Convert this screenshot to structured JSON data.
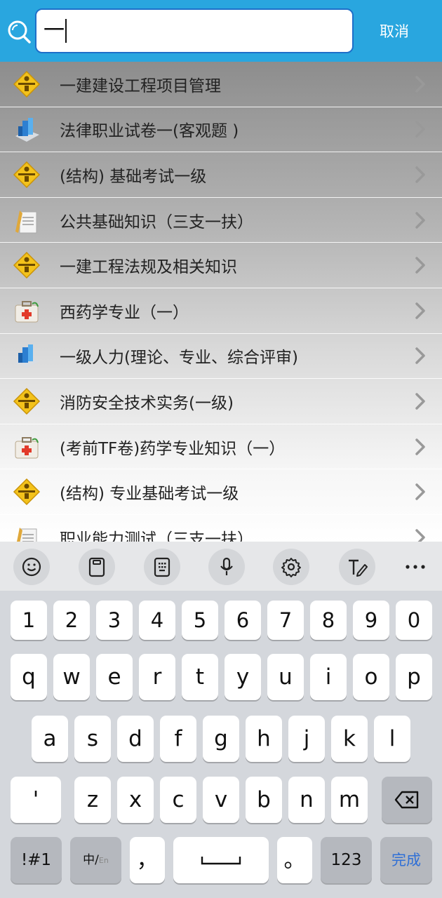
{
  "search": {
    "value": "一",
    "cancel_label": "取消"
  },
  "results": [
    {
      "label": "一建建设工程项目管理",
      "icon": "construction-sign-icon"
    },
    {
      "label": "法律职业试卷一(客观题 )",
      "icon": "buildings-icon"
    },
    {
      "label": "(结构) 基础考试一级",
      "icon": "construction-sign-icon"
    },
    {
      "label": "公共基础知识（三支一扶）",
      "icon": "document-icon"
    },
    {
      "label": "一建工程法规及相关知识",
      "icon": "construction-sign-icon"
    },
    {
      "label": "西药学专业（一）",
      "icon": "medical-kit-icon"
    },
    {
      "label": "一级人力(理论、专业、综合评审)",
      "icon": "buildings-icon"
    },
    {
      "label": "消防安全技术实务(一级)",
      "icon": "construction-sign-icon"
    },
    {
      "label": "(考前TF卷)药学专业知识（一）",
      "icon": "medical-kit-icon"
    },
    {
      "label": "(结构) 专业基础考试一级",
      "icon": "construction-sign-icon"
    },
    {
      "label": "职业能力测试（三支一扶）",
      "icon": "document-icon"
    }
  ],
  "keyboard": {
    "toolbar": [
      "emoji-icon",
      "clipboard-icon",
      "keyboard-layout-icon",
      "microphone-icon",
      "gear-icon",
      "handwriting-icon",
      "more-icon"
    ],
    "numbers": [
      "1",
      "2",
      "3",
      "4",
      "5",
      "6",
      "7",
      "8",
      "9",
      "0"
    ],
    "row1": [
      "q",
      "w",
      "e",
      "r",
      "t",
      "y",
      "u",
      "i",
      "o",
      "p"
    ],
    "row2": [
      "a",
      "s",
      "d",
      "f",
      "g",
      "h",
      "j",
      "k",
      "l"
    ],
    "row3": [
      "z",
      "x",
      "c",
      "v",
      "b",
      "n",
      "m"
    ],
    "apostrophe": "'",
    "symbols_label": "!#1",
    "lang_zh": "中/",
    "lang_en": "En",
    "comma": "，",
    "period": "。",
    "num_label": "123",
    "done_label": "完成"
  }
}
